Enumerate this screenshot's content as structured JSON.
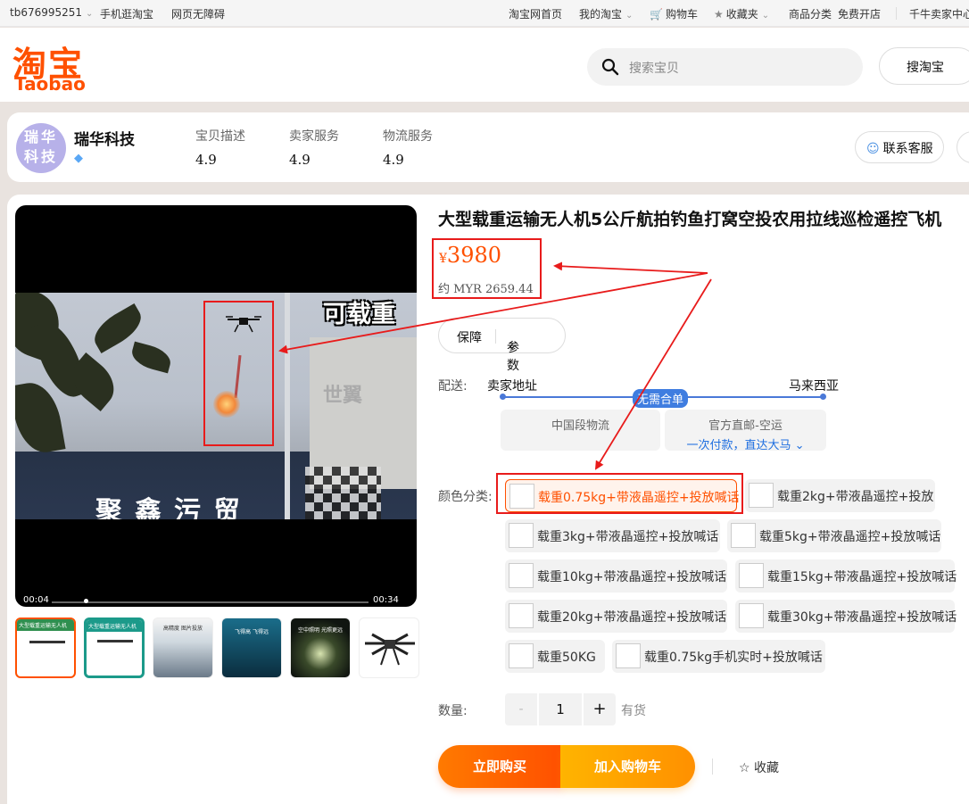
{
  "topbar": {
    "user": "tb676995251",
    "mobile": "手机逛淘宝",
    "accessibility": "网页无障碍",
    "home": "淘宝网首页",
    "my_taobao": "我的淘宝",
    "cart": "购物车",
    "favorites": "收藏夹",
    "categories": "商品分类",
    "open_shop": "免费开店",
    "seller_center": "千牛卖家中心"
  },
  "header": {
    "logo_cn": "淘宝",
    "logo_en": "Taobao",
    "search_placeholder": "搜索宝贝",
    "search_button": "搜淘宝"
  },
  "shop": {
    "avatar_text_1": "瑞华",
    "avatar_text_2": "科技",
    "name": "瑞华科技",
    "ratings": [
      {
        "label": "宝贝描述",
        "value": "4.9"
      },
      {
        "label": "卖家服务",
        "value": "4.9"
      },
      {
        "label": "物流服务",
        "value": "4.9"
      }
    ],
    "contact_button": "联系客服"
  },
  "gallery": {
    "overlay_caption": "可载重",
    "watermark": "世翼",
    "sign_text": "聚鑫污贸",
    "time_current": "00:04",
    "time_total": "00:34",
    "progress_fraction": 0.1,
    "thumb_captions": [
      "大型载重运输无人机",
      "大型载重运输无人机",
      "高精度 图片投放",
      "飞得高 飞得远",
      "空中照明 光照更远"
    ]
  },
  "product": {
    "title": "大型载重运输无人机5公斤航拍钓鱼打窝空投农用拉线巡检遥控飞机",
    "currency": "¥",
    "price": "3980",
    "approx_prefix": "约",
    "approx_price": "MYR 2659.44",
    "guarantee": "保障",
    "params": "参数"
  },
  "shipping": {
    "label": "配送:",
    "from": "卖家地址",
    "to": "马来西亚",
    "badge": "无需合单",
    "option1": "中国段物流",
    "option2": "官方直邮-空运",
    "option2_sub": "一次付款，直达大马"
  },
  "sku": {
    "label": "颜色分类:",
    "options": [
      "载重0.75kg+带液晶遥控+投放喊话",
      "载重2kg+带液晶遥控+投放",
      "载重3kg+带液晶遥控+投放喊话",
      "载重5kg+带液晶遥控+投放喊话",
      "载重10kg+带液晶遥控+投放喊话",
      "载重15kg+带液晶遥控+投放喊话",
      "载重20kg+带液晶遥控+投放喊话",
      "载重30kg+带液晶遥控+投放喊话",
      "载重50KG",
      "载重0.75kg手机实时+投放喊话"
    ],
    "selected_index": 0
  },
  "quantity": {
    "label": "数量:",
    "minus": "-",
    "value": "1",
    "plus": "+",
    "stock": "有货"
  },
  "actions": {
    "buy_now": "立即购买",
    "add_cart": "加入购物车",
    "favorite": "收藏"
  },
  "colors": {
    "brand": "#ff5000",
    "annotation": "#e81b1b",
    "route": "#3f7de0"
  }
}
